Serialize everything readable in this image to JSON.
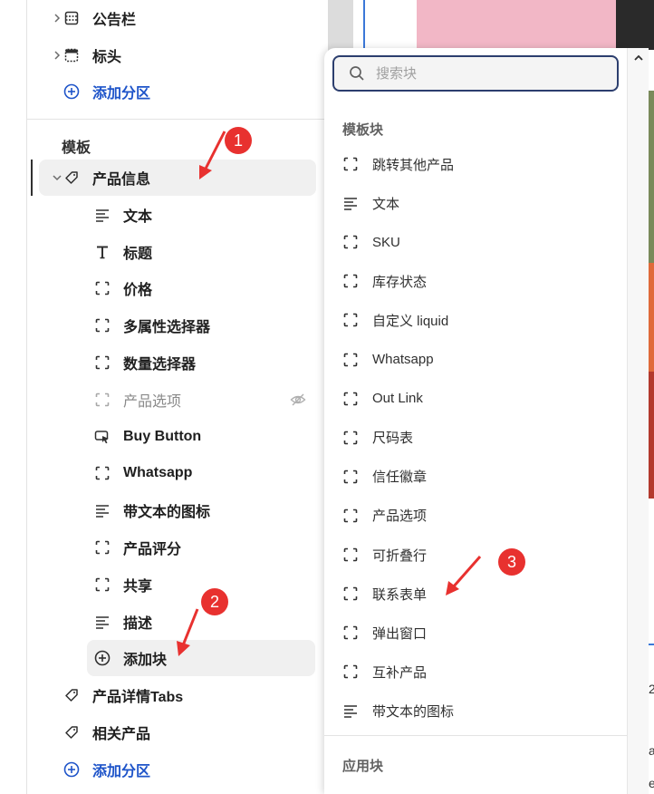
{
  "left_panel": {
    "top_rows": [
      {
        "label": "公告栏",
        "icon": "section-icon"
      },
      {
        "label": "标头",
        "icon": "header-section-icon"
      }
    ],
    "add_section_top": "添加分区",
    "template_label": "模板",
    "product_info": "产品信息",
    "blocks": [
      {
        "label": "文本",
        "icon": "text-lines-icon"
      },
      {
        "label": "标题",
        "icon": "heading-t-icon"
      },
      {
        "label": "价格",
        "icon": "block-bracket-icon"
      },
      {
        "label": "多属性选择器",
        "icon": "block-bracket-icon"
      },
      {
        "label": "数量选择器",
        "icon": "block-bracket-icon"
      },
      {
        "label": "产品选项",
        "icon": "block-bracket-icon",
        "hidden": true
      },
      {
        "label": "Buy Button",
        "icon": "cursor-click-icon"
      },
      {
        "label": "Whatsapp",
        "icon": "block-bracket-icon"
      },
      {
        "label": "带文本的图标",
        "icon": "text-lines-icon"
      },
      {
        "label": "产品评分",
        "icon": "block-bracket-icon"
      },
      {
        "label": "共享",
        "icon": "block-bracket-icon"
      },
      {
        "label": "描述",
        "icon": "text-lines-icon"
      }
    ],
    "add_block": "添加块",
    "bottom_sections": [
      {
        "label": "产品详情Tabs",
        "icon": "tag-icon"
      },
      {
        "label": "相关产品",
        "icon": "tag-icon"
      }
    ],
    "add_section_bottom": "添加分区"
  },
  "popover": {
    "search_placeholder": "搜索块",
    "template_blocks_label": "模板块",
    "items": [
      {
        "label": "跳转其他产品",
        "icon": "block-bracket-icon"
      },
      {
        "label": "文本",
        "icon": "text-lines-icon"
      },
      {
        "label": "SKU",
        "icon": "block-bracket-icon"
      },
      {
        "label": "库存状态",
        "icon": "block-bracket-icon"
      },
      {
        "label": "自定义 liquid",
        "icon": "block-bracket-icon"
      },
      {
        "label": "Whatsapp",
        "icon": "block-bracket-icon"
      },
      {
        "label": "Out Link",
        "icon": "block-bracket-icon"
      },
      {
        "label": "尺码表",
        "icon": "block-bracket-icon"
      },
      {
        "label": "信任徽章",
        "icon": "block-bracket-icon"
      },
      {
        "label": "产品选项",
        "icon": "block-bracket-icon"
      },
      {
        "label": "可折叠行",
        "icon": "block-bracket-icon"
      },
      {
        "label": "联系表单",
        "icon": "block-bracket-icon"
      },
      {
        "label": "弹出窗口",
        "icon": "block-bracket-icon"
      },
      {
        "label": "互补产品",
        "icon": "block-bracket-icon"
      },
      {
        "label": "带文本的图标",
        "icon": "text-lines-icon"
      }
    ],
    "app_blocks_label": "应用块"
  },
  "annotations": {
    "badge_1": "1",
    "badge_2": "2",
    "badge_3": "3"
  },
  "preview_fragments": {
    "f1": "2",
    "f2": "a",
    "f3": "e"
  },
  "colors": {
    "accent_blue": "#1e54c9",
    "badge_red": "#e8312f",
    "search_border": "#2c3e6e"
  }
}
